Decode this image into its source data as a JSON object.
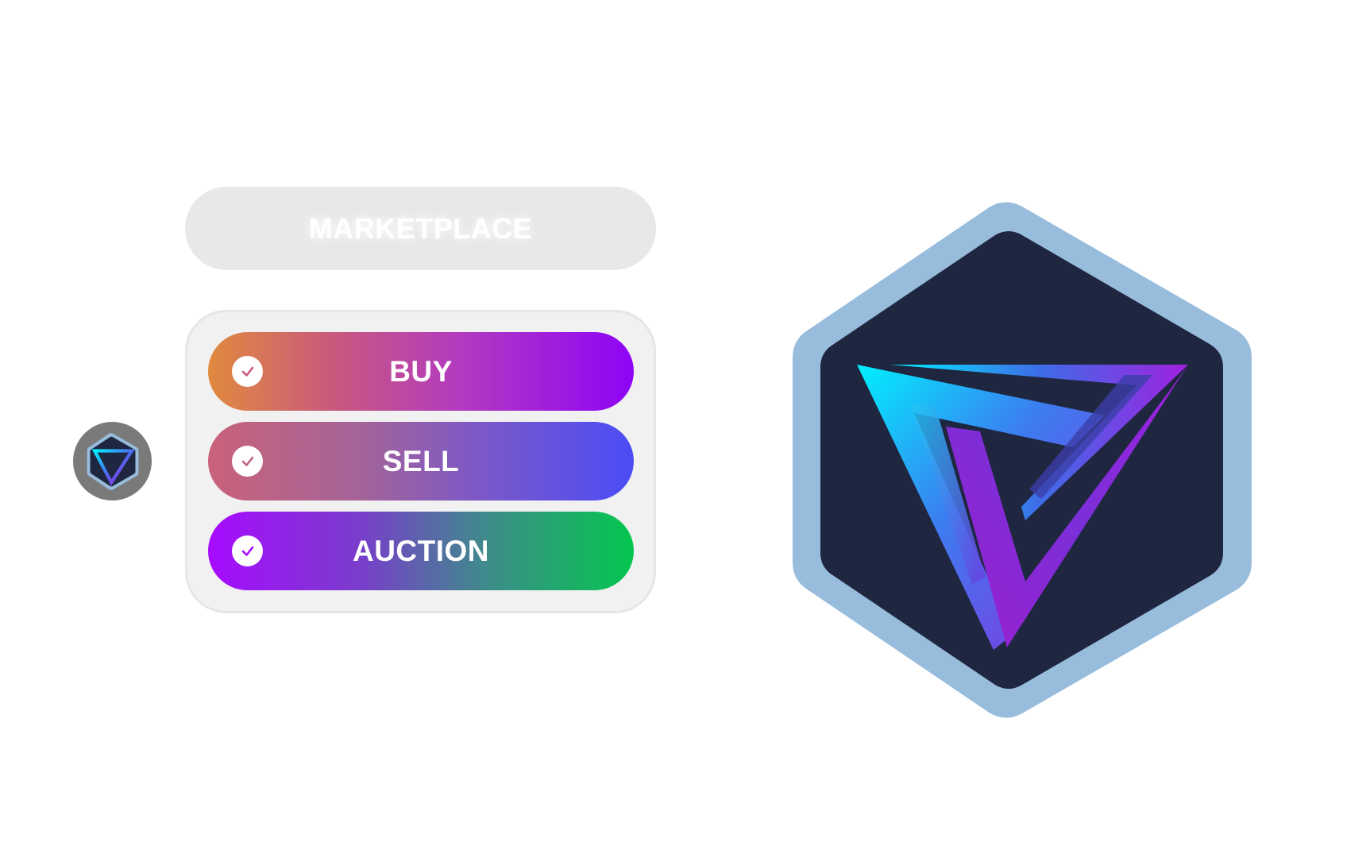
{
  "marketplace": {
    "title": "MARKETPLACE"
  },
  "options": {
    "buy": {
      "label": "BUY",
      "icon": "check-icon"
    },
    "sell": {
      "label": "SELL",
      "icon": "check-icon"
    },
    "auction": {
      "label": "AUCTION",
      "icon": "check-icon"
    }
  },
  "logo": {
    "icon": "hexagon-triangle-logo-icon"
  },
  "colors": {
    "buy_gradient_start": "#e08a3e",
    "buy_gradient_end": "#8e04f6",
    "sell_gradient_start": "#c9627a",
    "sell_gradient_end": "#4b4cf6",
    "auction_gradient_start": "#a70bff",
    "auction_gradient_end": "#04c74f",
    "logo_border": "#98bcdc",
    "logo_fill": "#1f2640",
    "logo_cyan": "#00f0ff",
    "logo_purple": "#a020e0"
  }
}
